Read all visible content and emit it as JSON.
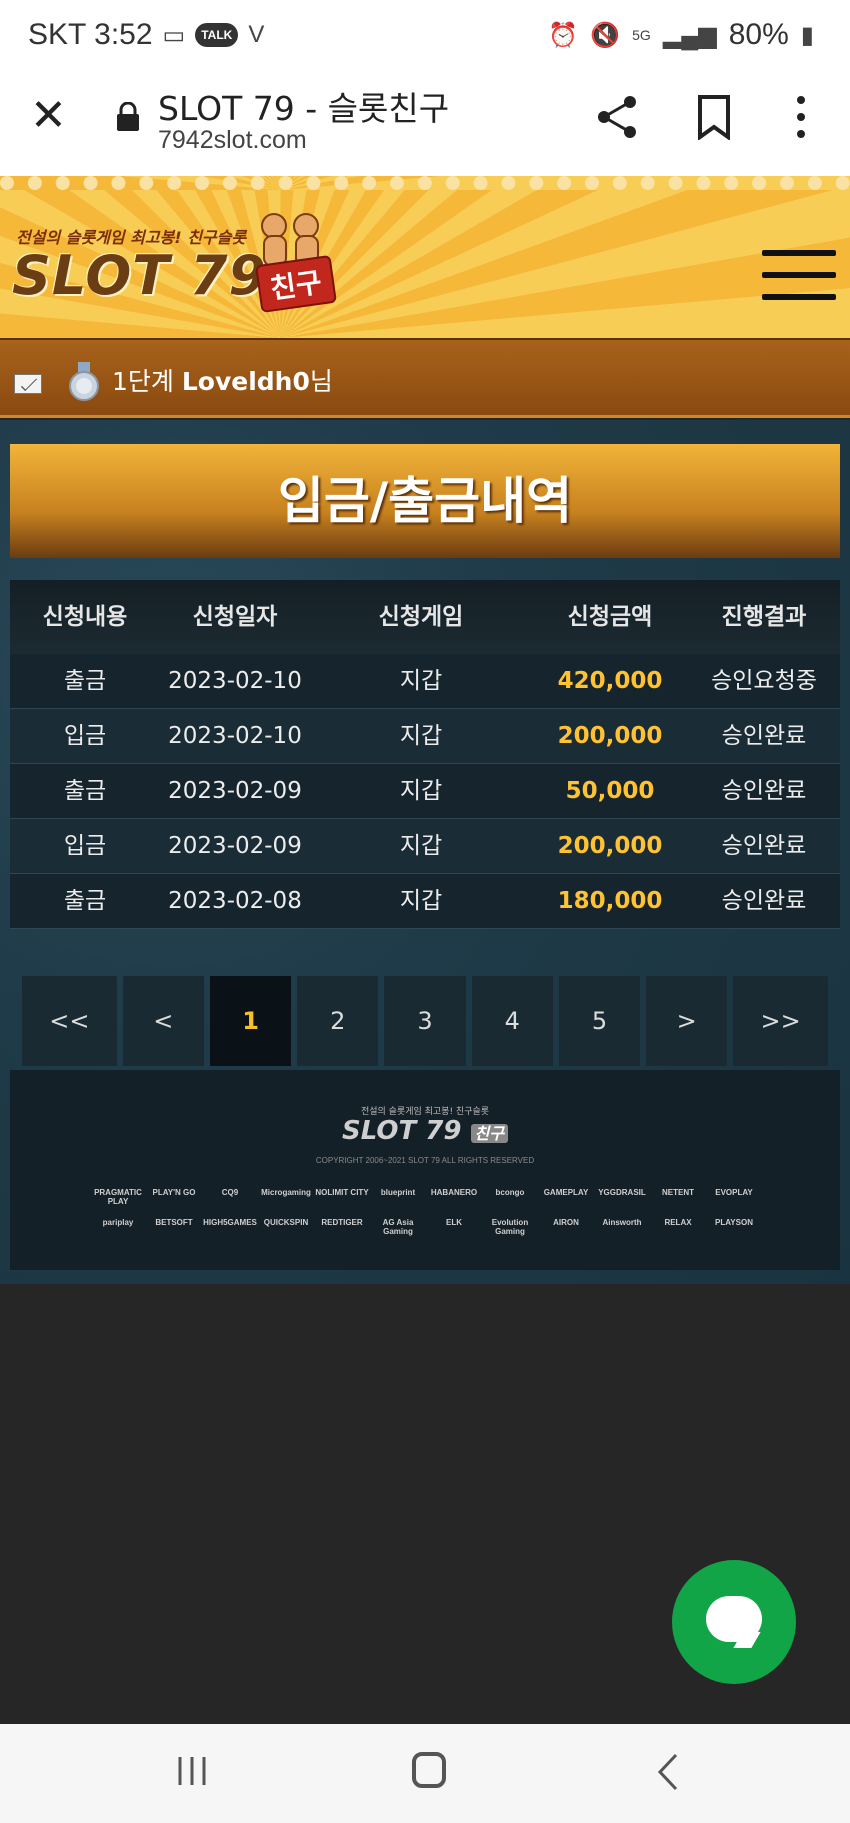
{
  "status_bar": {
    "carrier_time": "SKT 3:52",
    "talk_badge": "TALK",
    "network": "5G",
    "battery": "80%"
  },
  "browser": {
    "title": "SLOT 79 - 슬롯친구",
    "url": "7942slot.com"
  },
  "site": {
    "logo_tagline": "전설의 슬롯게임 최고봉! 친구슬롯",
    "logo_text": "SLOT 79",
    "logo_badge": "친구",
    "user_level": "1단계",
    "user_name": "Loveldh0",
    "user_suffix": "님",
    "page_title": "입금/출금내역"
  },
  "table": {
    "headers": [
      "신청내용",
      "신청일자",
      "신청게임",
      "신청금액",
      "진행결과"
    ],
    "rows": [
      {
        "type": "출금",
        "date": "2023-02-10",
        "game": "지갑",
        "amount": "420,000",
        "result": "승인요청중"
      },
      {
        "type": "입금",
        "date": "2023-02-10",
        "game": "지갑",
        "amount": "200,000",
        "result": "승인완료"
      },
      {
        "type": "출금",
        "date": "2023-02-09",
        "game": "지갑",
        "amount": "50,000",
        "result": "승인완료"
      },
      {
        "type": "입금",
        "date": "2023-02-09",
        "game": "지갑",
        "amount": "200,000",
        "result": "승인완료"
      },
      {
        "type": "출금",
        "date": "2023-02-08",
        "game": "지갑",
        "amount": "180,000",
        "result": "승인완료"
      }
    ]
  },
  "pager": {
    "first": "<<",
    "prev": "<",
    "pages": [
      "1",
      "2",
      "3",
      "4",
      "5"
    ],
    "next": ">",
    "last": ">>",
    "current": "1"
  },
  "footer": {
    "logo_tagline": "전설의 슬롯게임 최고봉! 친구슬롯",
    "logo_text": "SLOT 79",
    "logo_badge": "친구",
    "copyright": "COPYRIGHT 2006~2021 SLOT 79 ALL RIGHTS RESERVED",
    "providers": [
      "PRAGMATIC PLAY",
      "PLAY'N GO",
      "CQ9",
      "Microgaming",
      "NOLIMIT CITY",
      "blueprint",
      "HABANERO",
      "bcongo",
      "GAMEPLAY",
      "YGGDRASIL",
      "NETENT",
      "EVOPLAY",
      "pariplay",
      "BETSOFT",
      "HIGH5GAMES",
      "QUICKSPIN",
      "REDTIGER",
      "AG Asia Gaming",
      "ELK",
      "Evolution Gaming",
      "AIRON",
      "Ainsworth",
      "RELAX",
      "PLAYSON"
    ]
  },
  "colors": {
    "amount": "#ffc233",
    "active_page": "#f5c126",
    "chat_fab": "#12a548"
  }
}
